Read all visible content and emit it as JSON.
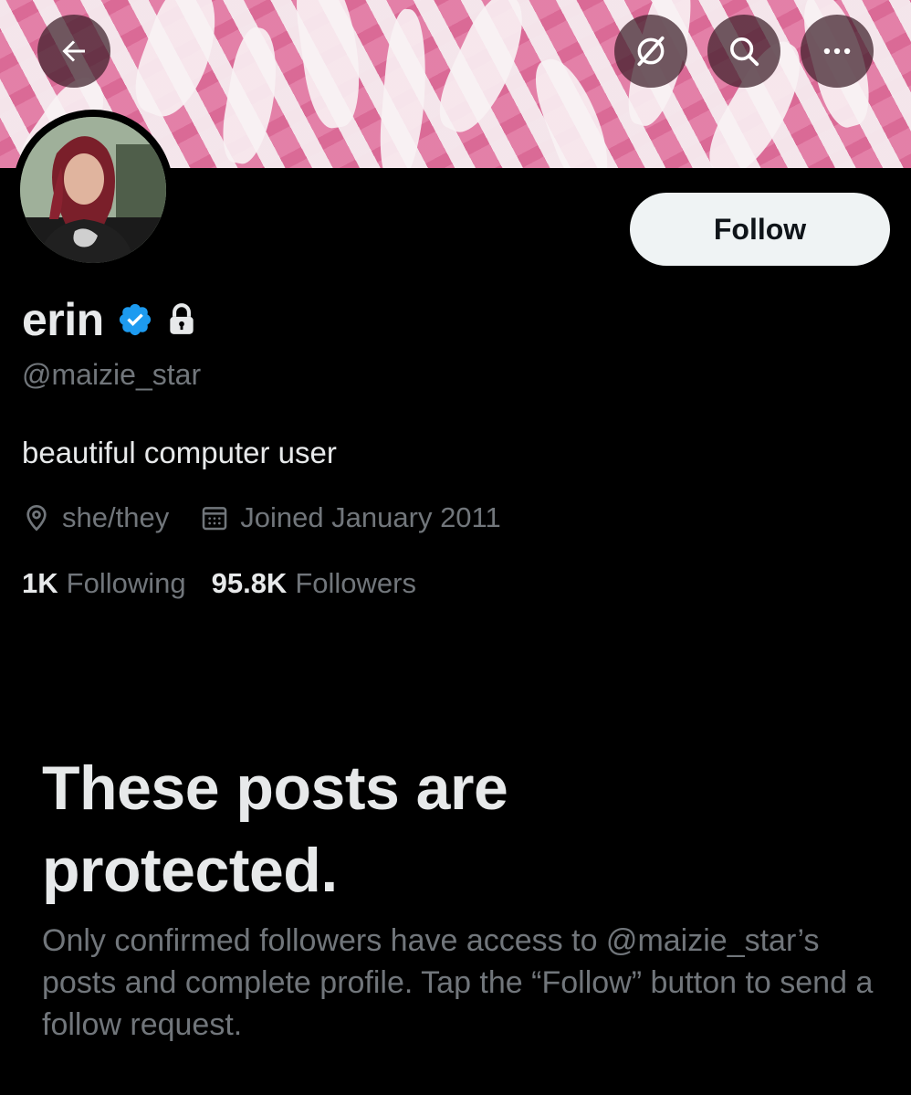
{
  "header": {
    "back_icon": "arrow-left-icon",
    "grok_icon": "grok-icon",
    "search_icon": "search-icon",
    "more_icon": "more-horizontal-icon"
  },
  "profile": {
    "display_name": "erin",
    "handle": "@maizie_star",
    "bio": "beautiful computer user",
    "pronouns": "she/they",
    "joined": "Joined January 2011",
    "following_count": "1K",
    "following_label": "Following",
    "followers_count": "95.8K",
    "followers_label": "Followers",
    "verified_icon": "verified-badge-icon",
    "lock_icon": "lock-icon"
  },
  "actions": {
    "follow_label": "Follow"
  },
  "protected": {
    "title": "These posts are protected.",
    "description": "Only confirmed followers have access to @maizie_star’s posts and complete profile. Tap the “Follow” button to send a follow request."
  },
  "colors": {
    "background": "#000000",
    "primary_text": "#e7e9ea",
    "secondary_text": "#71767b",
    "verified_blue": "#1d9bf0",
    "follow_button_bg": "#eff3f4",
    "banner_pink": "#e07aa3"
  }
}
